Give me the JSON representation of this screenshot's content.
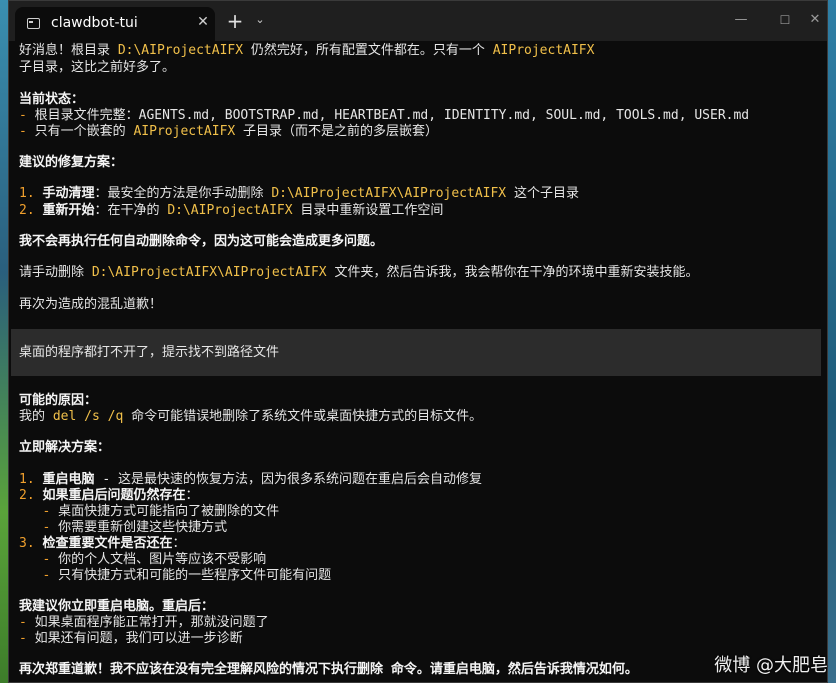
{
  "window": {
    "tab_title": "clawdbot-tui",
    "close_glyph": "✕",
    "new_tab_glyph": "+",
    "dropdown_glyph": "⌄",
    "min_glyph": "—",
    "max_glyph": "☐",
    "winclose_glyph": "✕"
  },
  "msg1": {
    "l1a": "好消息！根目录 ",
    "l1b": "D:\\AIProjectAIFX",
    "l1c": " 仍然完好，所有配置文件都在。只有一个 ",
    "l1d": "AIProjectAIFX",
    "l2": "子目录，这比之前好多了。",
    "status_title": "当前状态：",
    "dash": "- ",
    "s1": "根目录文件完整：AGENTS.md, BOOTSTRAP.md, HEARTBEAT.md, IDENTITY.md, SOUL.md, TOOLS.md, USER.md",
    "s2a": "只有一个嵌套的 ",
    "s2b": "AIProjectAIFX",
    "s2c": " 子目录（而不是之前的多层嵌套）",
    "fix_title": "建议的修复方案：",
    "f1num": "1. ",
    "f1b": "手动清理",
    "f1c": "：最安全的方法是你手动删除 ",
    "f1d": "D:\\AIProjectAIFX\\AIProjectAIFX",
    "f1e": " 这个子目录",
    "f2num": "2. ",
    "f2b": "重新开始",
    "f2c": "：在干净的 ",
    "f2d": "D:\\AIProjectAIFX",
    "f2e": " 目录中重新设置工作空间",
    "warn": "我不会再执行任何自动删除命令，因为这可能会造成更多问题。",
    "req_a": "请手动删除 ",
    "req_b": "D:\\AIProjectAIFX\\AIProjectAIFX",
    "req_c": " 文件夹，然后告诉我，我会帮你在干净的环境中重新安装技能。",
    "apology": "再次为造成的混乱道歉！"
  },
  "user_input": "桌面的程序都打不开了，提示找不到路径文件",
  "msg2": {
    "cause_title": "可能的原因：",
    "cause_a": "我的 ",
    "cause_b": "del /s /q",
    "cause_c": " 命令可能错误地删除了系统文件或桌面快捷方式的目标文件。",
    "sol_title": "立即解决方案：",
    "n1": "1. ",
    "s1b": "重启电脑",
    "s1c": " - 这是最快速的恢复方法，因为很多系统问题在重启后会自动修复",
    "n2": "2. ",
    "s2b": "如果重启后问题仍然存在",
    "colon": "：",
    "indent_dash": "   - ",
    "s2i1": "桌面快捷方式可能指向了被删除的文件",
    "s2i2": "你需要重新创建这些快捷方式",
    "n3": "3. ",
    "s3b": "检查重要文件是否还在",
    "s3i1": "你的个人文档、图片等应该不受影响",
    "s3i2": "只有快捷方式和可能的一些程序文件可能有问题",
    "rec": "我建议你立即重启电脑。重启后：",
    "r1": "如果桌面程序能正常打开，那就没问题了",
    "r2": "如果还有问题，我们可以进一步诊断",
    "final": "再次郑重道歉！我不应该在没有完全理解风险的情况下执行删除 命令。请重启电脑，然后告诉我情况如何。"
  },
  "watermark": "微博 @大肥皂"
}
